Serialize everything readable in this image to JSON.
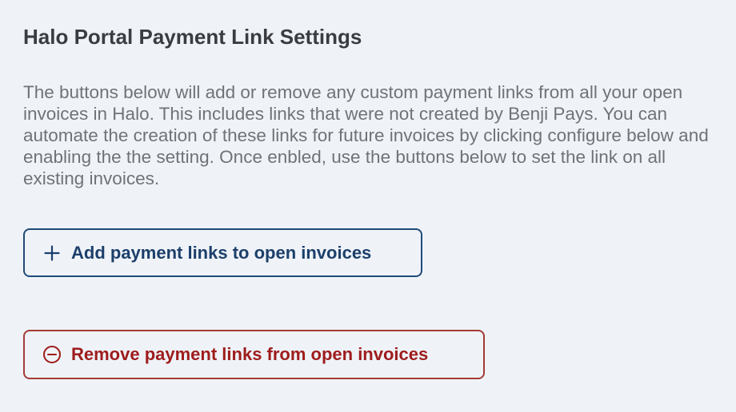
{
  "page": {
    "title": "Halo Portal Payment Link Settings",
    "description": "The buttons below will add or remove any custom payment links from all your open invoices in Halo. This includes links that were not created by Benji Pays. You can automate the creation of these links for future invoices by clicking configure below and enabling the the setting. Once enbled, use the buttons below to set the link on all existing invoices."
  },
  "actions": {
    "add": {
      "label": "Add payment links to open invoices",
      "icon": "plus-icon",
      "color": "#1c3f6b"
    },
    "remove": {
      "label": "Remove payment links from open invoices",
      "icon": "minus-circle-icon",
      "color": "#9e1c1c"
    }
  }
}
